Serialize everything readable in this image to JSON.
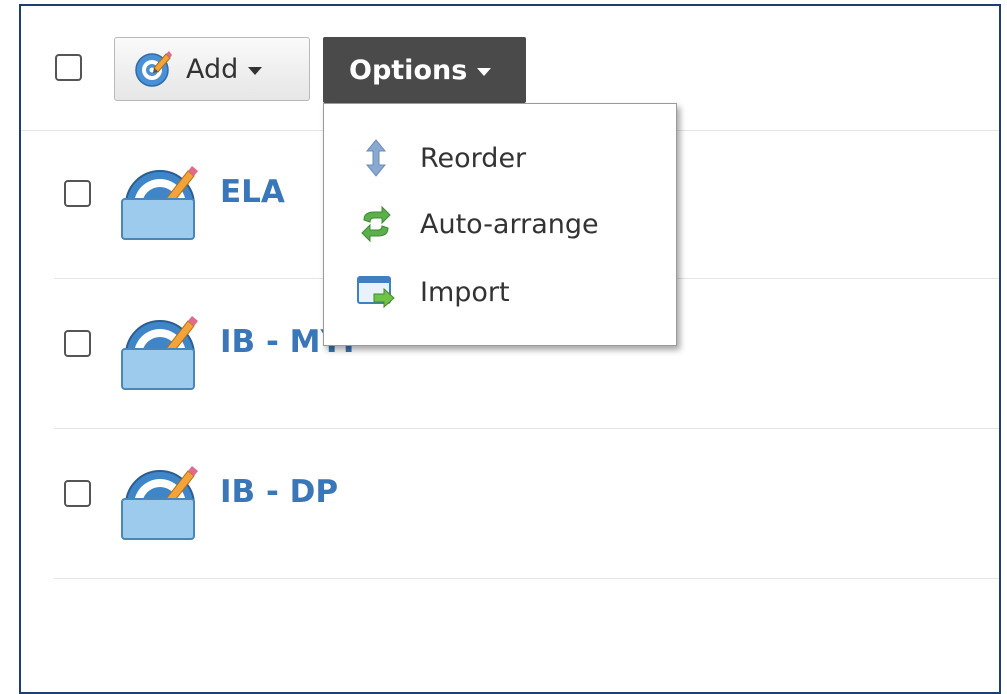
{
  "toolbar": {
    "add_label": "Add",
    "options_label": "Options"
  },
  "options_menu": {
    "items": [
      {
        "label": "Reorder",
        "icon": "reorder-arrows-icon"
      },
      {
        "label": "Auto-arrange",
        "icon": "auto-arrange-icon"
      },
      {
        "label": "Import",
        "icon": "import-icon"
      }
    ]
  },
  "list": {
    "rows": [
      {
        "label": "ELA",
        "icon": "gradebook-folder-icon"
      },
      {
        "label": "IB - MYP",
        "icon": "gradebook-folder-icon"
      },
      {
        "label": "IB - DP",
        "icon": "gradebook-folder-icon"
      }
    ]
  },
  "colors": {
    "frame_border": "#1b3f6e",
    "options_button": "#4a4a4a",
    "row_link": "#3a77b8"
  }
}
